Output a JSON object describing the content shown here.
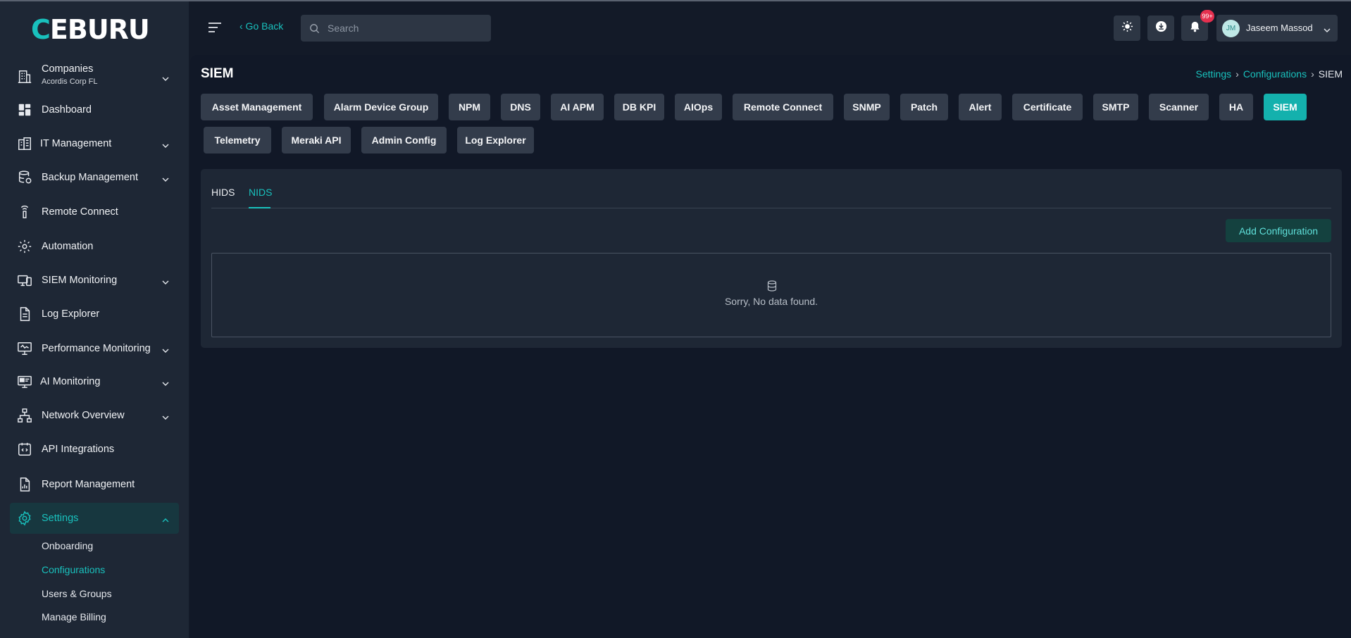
{
  "app": {
    "logo_text_first": "C",
    "logo_text_rest": "EBURU",
    "accent_color": "#19c1bd"
  },
  "header": {
    "go_back": "‹ Go Back",
    "search_placeholder": "Search",
    "notification_count": "99+",
    "user_initials": "JM",
    "user_name": "Jaseem Massod"
  },
  "sidebar": {
    "companies_label": "Companies",
    "companies_sub": "Acordis Corp FL",
    "items": [
      {
        "label": "Dashboard",
        "icon": "dashboard-icon"
      },
      {
        "label": "IT Management",
        "icon": "building-icon"
      },
      {
        "label": "Backup Management",
        "icon": "database-backup-icon"
      },
      {
        "label": "Remote Connect",
        "icon": "antenna-icon"
      },
      {
        "label": "Automation",
        "icon": "gear-automation-icon"
      },
      {
        "label": "SIEM Monitoring",
        "icon": "devices-icon"
      },
      {
        "label": "Log Explorer",
        "icon": "document-icon"
      },
      {
        "label": "Performance Monitoring",
        "icon": "monitor-icon"
      },
      {
        "label": "AI Monitoring",
        "icon": "ai-monitor-icon"
      },
      {
        "label": "Network Overview",
        "icon": "network-icon"
      },
      {
        "label": "API Integrations",
        "icon": "api-icon"
      },
      {
        "label": "Report Management",
        "icon": "report-icon"
      },
      {
        "label": "Settings",
        "icon": "settings-icon"
      }
    ],
    "settings_subitems": [
      "Onboarding",
      "Configurations",
      "Users & Groups",
      "Manage Billing"
    ]
  },
  "page": {
    "title": "SIEM",
    "breadcrumb": [
      "Settings",
      "Configurations",
      "SIEM"
    ],
    "config_tabs": [
      "Asset Management",
      "Alarm Device Group",
      "NPM",
      "DNS",
      "AI APM",
      "DB KPI",
      "AIOps",
      "Remote Connect",
      "SNMP",
      "Patch",
      "Alert",
      "Certificate",
      "SMTP",
      "Scanner",
      "HA",
      "SIEM",
      "Telemetry",
      "Meraki API",
      "Admin Config",
      "Log Explorer"
    ],
    "active_tab": "SIEM",
    "sub_tabs": [
      "HIDS",
      "NIDS"
    ],
    "active_sub_tab": "NIDS",
    "add_button": "Add Configuration",
    "empty_message": "Sorry, No data found."
  }
}
